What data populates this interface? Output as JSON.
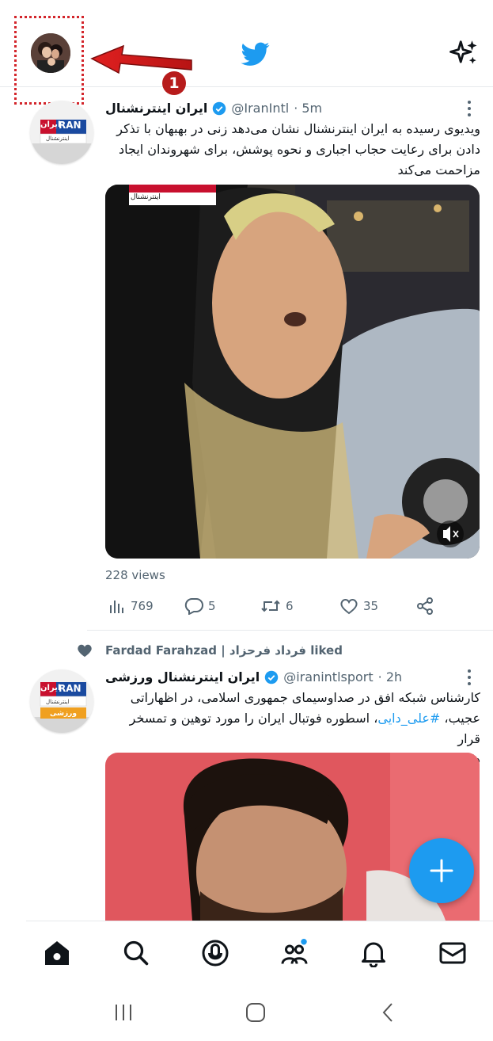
{
  "annotation": {
    "step_number": "1"
  },
  "colors": {
    "accent": "#1d9bf0",
    "annotation_red": "#d3252b",
    "text_secondary": "#536471"
  },
  "header": {
    "profile_avatar_icon": "user-avatar",
    "logo_icon": "twitter-bird-icon",
    "sparkle_icon": "sparkle-icon"
  },
  "tweets": [
    {
      "author_name": "ایران اینترنشنال",
      "handle": "@IranIntl",
      "time": "· 5m",
      "text": "ویدیوی رسیده به ایران اینترنشنال نشان می‌دهد زنی در بهبهان با تذکر دادن برای رعایت حجاب اجباری و نحوه پوشش، برای شهروندان ایجاد مزاحمت می‌کند",
      "avatar_label_top": "RAN",
      "avatar_label_fa": "ایران",
      "avatar_label_sub": "اینترنشنال",
      "media_label": "اینترنشنال",
      "views": "228 views",
      "stats": {
        "views": "769",
        "replies": "5",
        "retweets": "6",
        "likes": "35"
      }
    },
    {
      "liked_by": "Fardad Farahzad | فرداد فرحزاد",
      "liked_suffix": "liked",
      "author_name": "ایران اینترنشنال ورزشی",
      "handle": "@iranintlsport",
      "time": "· 2h",
      "text_line1": "کارشناس شبکه افق در صداوسیمای جمهوری اسلامی، در اظهاراتی",
      "text_line2_pre": "عجیب، ",
      "hashtag": "#علی_دایی",
      "text_line2_post": "، اسطوره فوتبال ایران را مورد توهین و تمسخر قرار",
      "text_line3": "داد.",
      "avatar_label_top": "RAN",
      "avatar_label_fa": "ایران",
      "avatar_label_sub": "اینترنشنال",
      "avatar_label_sport": "ورزشی"
    }
  ],
  "fab": {
    "icon": "plus-icon"
  },
  "bottom_nav": [
    "home-icon",
    "search-icon",
    "spaces-icon",
    "communities-icon",
    "notifications-icon",
    "messages-icon"
  ],
  "system_nav": [
    "recents-icon",
    "home-button-icon",
    "back-icon"
  ]
}
